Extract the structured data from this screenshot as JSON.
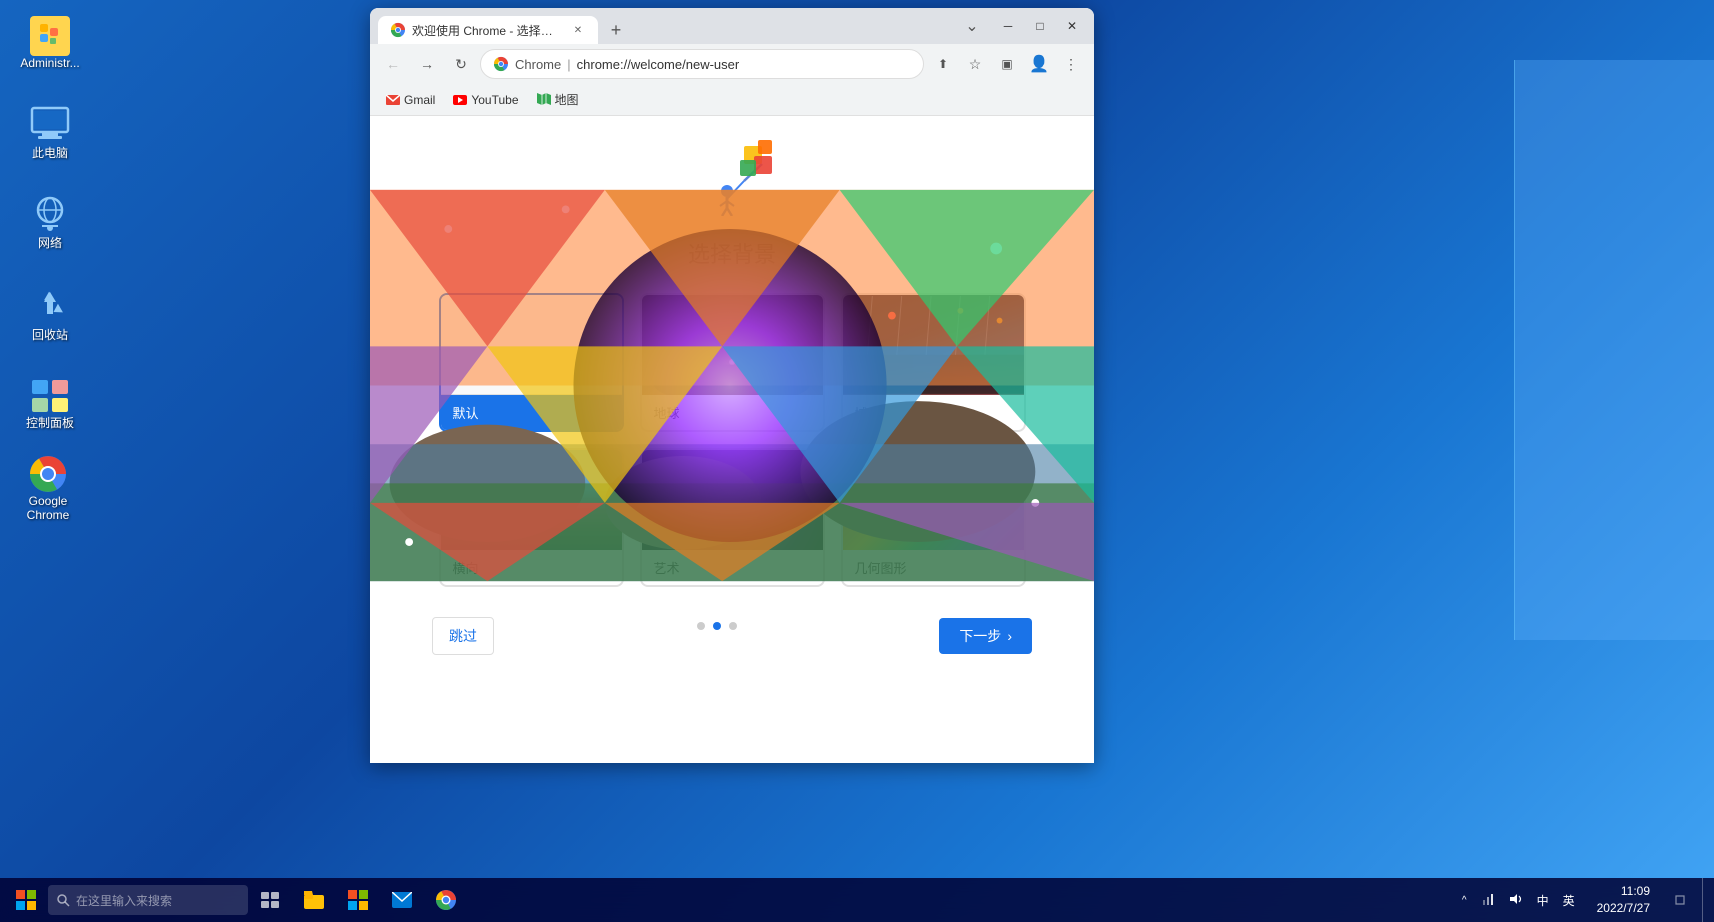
{
  "desktop": {
    "icons": [
      {
        "id": "admin",
        "label": "Administr...",
        "type": "avatar"
      },
      {
        "id": "computer",
        "label": "此电脑",
        "type": "computer"
      },
      {
        "id": "network",
        "label": "网络",
        "type": "network"
      },
      {
        "id": "recycle",
        "label": "回收站",
        "type": "recycle"
      },
      {
        "id": "control",
        "label": "控制面板",
        "type": "control"
      },
      {
        "id": "chrome",
        "label": "Google Chrome",
        "type": "chrome"
      }
    ]
  },
  "browser": {
    "tab": {
      "title": "欢迎使用 Chrome - 选择背景",
      "favicon": "chrome"
    },
    "url": "chrome://welcome/new-user",
    "url_display": "Chrome  |  chrome://welcome/new-user",
    "bookmarks": [
      {
        "id": "gmail",
        "label": "Gmail",
        "color": "#EA4335"
      },
      {
        "id": "youtube",
        "label": "YouTube",
        "color": "#FF0000"
      },
      {
        "id": "maps",
        "label": "地图",
        "color": "#34A853"
      }
    ]
  },
  "page": {
    "title": "选择背景",
    "themes": [
      {
        "id": "default",
        "label": "默认",
        "type": "default",
        "selected": true
      },
      {
        "id": "earth",
        "label": "地球",
        "type": "earth",
        "selected": false
      },
      {
        "id": "city",
        "label": "城市景观",
        "type": "city",
        "selected": false
      },
      {
        "id": "landscape",
        "label": "横向",
        "type": "landscape",
        "selected": false
      },
      {
        "id": "art",
        "label": "艺术",
        "type": "art",
        "selected": false
      },
      {
        "id": "geometric",
        "label": "几何图形",
        "type": "geometric",
        "selected": false
      }
    ],
    "pagination": {
      "total": 3,
      "current": 1
    },
    "buttons": {
      "skip": "跳过",
      "next": "下一步"
    }
  },
  "taskbar": {
    "start_label": "⊞",
    "search_placeholder": "在这里输入来搜索",
    "tray": {
      "language": "英",
      "time": "11:09",
      "date": "2022/7/27"
    }
  },
  "window_controls": {
    "minimize": "─",
    "maximize": "□",
    "close": "✕",
    "dots": "⋮"
  }
}
